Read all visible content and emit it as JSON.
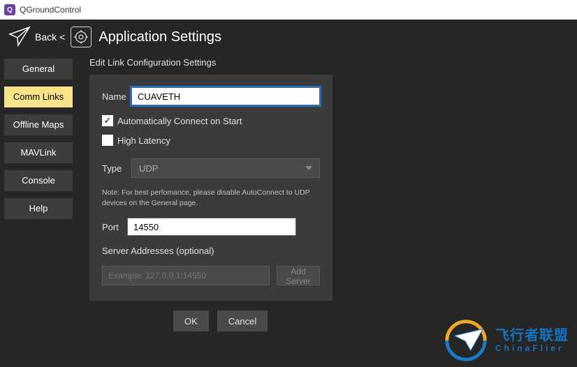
{
  "window": {
    "title": "QGroundControl"
  },
  "header": {
    "back": "Back",
    "lt": "<",
    "title": "Application Settings"
  },
  "sidebar": {
    "items": [
      {
        "label": "General"
      },
      {
        "label": "Comm Links"
      },
      {
        "label": "Offline Maps"
      },
      {
        "label": "MAVLink"
      },
      {
        "label": "Console"
      },
      {
        "label": "Help"
      }
    ],
    "active_index": 1
  },
  "section": {
    "title": "Edit Link Configuration Settings"
  },
  "form": {
    "name_label": "Name",
    "name_value": "CUAVETH",
    "auto_connect": {
      "checked": true,
      "label": "Automatically Connect on Start",
      "mark": "✓"
    },
    "high_latency": {
      "checked": false,
      "label": "High Latency"
    },
    "type_label": "Type",
    "type_selected": "UDP",
    "note": "Note: For best perfomance, please disable AutoConnect to UDP devices on the General page.",
    "port_label": "Port",
    "port_value": "14550",
    "server_label": "Server Addresses (optional)",
    "server_placeholder": "Example: 127.0.0.1:14550",
    "add_server": "Add Server"
  },
  "buttons": {
    "ok": "OK",
    "cancel": "Cancel"
  },
  "watermark": {
    "cn": "飞行者联盟",
    "en": "ChinaFlier"
  }
}
